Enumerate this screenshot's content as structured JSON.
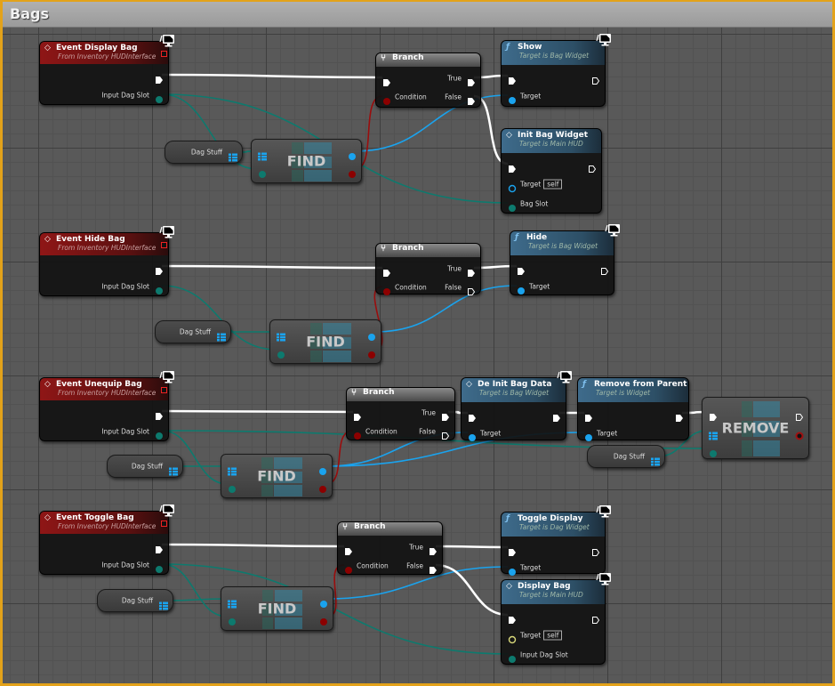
{
  "window": {
    "title": "Bags",
    "frame_color": "#e3a21a"
  },
  "colors": {
    "exec": "#ffffff",
    "object": "#1aa3ee",
    "bool": "#8c0000",
    "struct": "#0d7a6e",
    "self_yellow": "#d8d87a"
  },
  "nodes": [
    {
      "id": "e1",
      "kind": "event",
      "title": "Event Display Bag",
      "subtitle": "From Inventory HUDInterface",
      "monitor": true,
      "delegate": true,
      "rows": [
        {
          "right": {
            "type": "exec"
          }
        },
        {
          "right": {
            "type": "struct",
            "label": "Input Dag Slot"
          }
        }
      ]
    },
    {
      "id": "v1",
      "kind": "var",
      "label": "Dag Stuff"
    },
    {
      "id": "f1",
      "kind": "macro",
      "label": "FIND",
      "rows": [
        {
          "left": {
            "type": "array"
          },
          "right": {
            "type": "obj"
          }
        },
        {
          "left": {
            "type": "struct"
          },
          "right": {
            "type": "bool"
          }
        }
      ]
    },
    {
      "id": "b1",
      "kind": "branch",
      "title": "Branch",
      "rows": [
        {
          "left": {
            "type": "exec"
          },
          "right": {
            "type": "exec",
            "label": "True"
          }
        },
        {
          "left": {
            "type": "bool",
            "label": "Condition"
          },
          "right": {
            "type": "exec",
            "label": "False"
          }
        }
      ]
    },
    {
      "id": "show",
      "kind": "func",
      "icon": "f",
      "title": "Show",
      "subtitle": "Target is Bag Widget",
      "monitor": true,
      "rows": [
        {
          "left": {
            "type": "exec"
          },
          "right": {
            "type": "exec-empty"
          }
        },
        {
          "left": {
            "type": "obj",
            "label": "Target"
          }
        }
      ]
    },
    {
      "id": "init",
      "kind": "func",
      "icon": "event",
      "title": "Init Bag Widget",
      "subtitle": "Target is Main HUD",
      "rows": [
        {
          "left": {
            "type": "exec"
          },
          "right": {
            "type": "exec-empty"
          }
        },
        {
          "left": {
            "type": "obj-empty",
            "label": "Target",
            "self": "self"
          }
        },
        {
          "left": {
            "type": "struct",
            "label": "Bag Slot"
          }
        }
      ]
    },
    {
      "id": "e2",
      "kind": "event",
      "title": "Event Hide Bag",
      "subtitle": "From Inventory HUDInterface",
      "monitor": true,
      "delegate": true,
      "rows": [
        {
          "right": {
            "type": "exec"
          }
        },
        {
          "right": {
            "type": "struct",
            "label": "Input Dag Slot"
          }
        }
      ]
    },
    {
      "id": "v2",
      "kind": "var",
      "label": "Dag Stuff"
    },
    {
      "id": "f2",
      "kind": "macro",
      "label": "FIND",
      "rows": [
        {
          "left": {
            "type": "array"
          },
          "right": {
            "type": "obj"
          }
        },
        {
          "left": {
            "type": "struct"
          },
          "right": {
            "type": "bool"
          }
        }
      ]
    },
    {
      "id": "b2",
      "kind": "branch",
      "title": "Branch",
      "rows": [
        {
          "left": {
            "type": "exec"
          },
          "right": {
            "type": "exec",
            "label": "True"
          }
        },
        {
          "left": {
            "type": "bool",
            "label": "Condition"
          },
          "right": {
            "type": "exec-empty",
            "label": "False"
          }
        }
      ]
    },
    {
      "id": "hide",
      "kind": "func",
      "icon": "f",
      "title": "Hide",
      "subtitle": "Target is Bag Widget",
      "monitor": true,
      "rows": [
        {
          "left": {
            "type": "exec"
          },
          "right": {
            "type": "exec-empty"
          }
        },
        {
          "left": {
            "type": "obj",
            "label": "Target"
          }
        }
      ]
    },
    {
      "id": "e3",
      "kind": "event",
      "title": "Event Unequip Bag",
      "subtitle": "From Inventory HUDInterface",
      "monitor": true,
      "delegate": true,
      "rows": [
        {
          "right": {
            "type": "exec"
          }
        },
        {
          "right": {
            "type": "struct",
            "label": "Input Dag Slot"
          }
        }
      ]
    },
    {
      "id": "v3",
      "kind": "var",
      "label": "Dag Stuff"
    },
    {
      "id": "f3",
      "kind": "macro",
      "label": "FIND",
      "rows": [
        {
          "left": {
            "type": "array"
          },
          "right": {
            "type": "obj"
          }
        },
        {
          "left": {
            "type": "struct"
          },
          "right": {
            "type": "bool"
          }
        }
      ]
    },
    {
      "id": "b3",
      "kind": "branch",
      "title": "Branch",
      "rows": [
        {
          "left": {
            "type": "exec"
          },
          "right": {
            "type": "exec",
            "label": "True"
          }
        },
        {
          "left": {
            "type": "bool",
            "label": "Condition"
          },
          "right": {
            "type": "exec-empty",
            "label": "False"
          }
        }
      ]
    },
    {
      "id": "deinit",
      "kind": "func",
      "icon": "event",
      "title": "De Init Bag Data",
      "subtitle": "Target is Bag Widget",
      "monitor": true,
      "rows": [
        {
          "left": {
            "type": "exec"
          },
          "right": {
            "type": "exec"
          }
        },
        {
          "left": {
            "type": "obj",
            "label": "Target"
          }
        }
      ]
    },
    {
      "id": "rfp",
      "kind": "func",
      "icon": "f",
      "title": "Remove from Parent",
      "subtitle": "Target is Widget",
      "rows": [
        {
          "left": {
            "type": "exec"
          },
          "right": {
            "type": "exec"
          }
        },
        {
          "left": {
            "type": "obj",
            "label": "Target"
          }
        }
      ]
    },
    {
      "id": "v4",
      "kind": "var",
      "label": "Dag Stuff"
    },
    {
      "id": "rm",
      "kind": "macro",
      "label": "REMOVE",
      "rows": [
        {
          "left": {
            "type": "exec"
          },
          "right": {
            "type": "exec-empty"
          }
        },
        {
          "left": {
            "type": "array"
          },
          "right": {
            "type": "bool-ring"
          }
        },
        {
          "left": {
            "type": "struct"
          }
        }
      ]
    },
    {
      "id": "e4",
      "kind": "event",
      "title": "Event Toggle Bag",
      "subtitle": "From Inventory HUDInterface",
      "monitor": true,
      "delegate": true,
      "rows": [
        {
          "right": {
            "type": "exec"
          }
        },
        {
          "right": {
            "type": "struct",
            "label": "Input Dag Slot"
          }
        }
      ]
    },
    {
      "id": "v5",
      "kind": "var",
      "label": "Dag Stuff"
    },
    {
      "id": "f4",
      "kind": "macro",
      "label": "FIND",
      "rows": [
        {
          "left": {
            "type": "array"
          },
          "right": {
            "type": "obj"
          }
        },
        {
          "left": {
            "type": "struct"
          },
          "right": {
            "type": "bool"
          }
        }
      ]
    },
    {
      "id": "b4",
      "kind": "branch",
      "title": "Branch",
      "rows": [
        {
          "left": {
            "type": "exec"
          },
          "right": {
            "type": "exec",
            "label": "True"
          }
        },
        {
          "left": {
            "type": "bool",
            "label": "Condition"
          },
          "right": {
            "type": "exec",
            "label": "False"
          }
        }
      ]
    },
    {
      "id": "tog",
      "kind": "func",
      "icon": "f",
      "title": "Toggle Display",
      "subtitle": "Target is Dag Widget",
      "monitor": true,
      "rows": [
        {
          "left": {
            "type": "exec"
          },
          "right": {
            "type": "exec-empty"
          }
        },
        {
          "left": {
            "type": "obj",
            "label": "Target"
          }
        }
      ]
    },
    {
      "id": "disp",
      "kind": "func",
      "icon": "event",
      "title": "Display Bag",
      "subtitle": "Target is Main HUD",
      "monitor": true,
      "rows": [
        {
          "left": {
            "type": "exec"
          },
          "right": {
            "type": "exec-empty"
          }
        },
        {
          "left": {
            "type": "self-y",
            "label": "Target",
            "self": "self"
          }
        },
        {
          "left": {
            "type": "struct",
            "label": "Input Dag Slot"
          }
        }
      ]
    }
  ],
  "connections": [
    [
      "e1.r.0",
      "b1.l.0",
      "exec"
    ],
    [
      "e1.r.1",
      "f1.l.1",
      "struct"
    ],
    [
      "e1.r.1",
      "init.l.2",
      "struct"
    ],
    [
      "v1.r.0",
      "f1.l.0",
      "struct"
    ],
    [
      "f1.r.0",
      "show.l.1",
      "obj"
    ],
    [
      "f1.r.1",
      "b1.l.1",
      "bool"
    ],
    [
      "b1.r.0",
      "show.l.0",
      "exec"
    ],
    [
      "b1.r.1",
      "init.l.0",
      "exec"
    ],
    [
      "e2.r.0",
      "b2.l.0",
      "exec"
    ],
    [
      "e2.r.1",
      "f2.l.1",
      "struct"
    ],
    [
      "v2.r.0",
      "f2.l.0",
      "struct"
    ],
    [
      "f2.r.0",
      "hide.l.1",
      "obj"
    ],
    [
      "f2.r.1",
      "b2.l.1",
      "bool"
    ],
    [
      "b2.r.0",
      "hide.l.0",
      "exec"
    ],
    [
      "e3.r.0",
      "b3.l.0",
      "exec"
    ],
    [
      "e3.r.1",
      "f3.l.1",
      "struct"
    ],
    [
      "e3.r.1",
      "rm.l.2",
      "struct"
    ],
    [
      "v3.r.0",
      "f3.l.0",
      "struct"
    ],
    [
      "f3.r.0",
      "deinit.l.1",
      "obj"
    ],
    [
      "f3.r.0",
      "rfp.l.1",
      "obj"
    ],
    [
      "f3.r.1",
      "b3.l.1",
      "bool"
    ],
    [
      "b3.r.0",
      "deinit.l.0",
      "exec"
    ],
    [
      "deinit.r.0",
      "rfp.l.0",
      "exec"
    ],
    [
      "rfp.r.0",
      "rm.l.0",
      "exec"
    ],
    [
      "v4.r.0",
      "rm.l.1",
      "struct"
    ],
    [
      "e4.r.0",
      "b4.l.0",
      "exec"
    ],
    [
      "e4.r.1",
      "f4.l.1",
      "struct"
    ],
    [
      "e4.r.1",
      "disp.l.2",
      "struct"
    ],
    [
      "v5.r.0",
      "f4.l.0",
      "struct"
    ],
    [
      "f4.r.0",
      "tog.l.1",
      "obj"
    ],
    [
      "f4.r.1",
      "b4.l.1",
      "bool"
    ],
    [
      "b4.r.0",
      "tog.l.0",
      "exec"
    ],
    [
      "b4.r.1",
      "disp.l.0",
      "exec"
    ]
  ]
}
